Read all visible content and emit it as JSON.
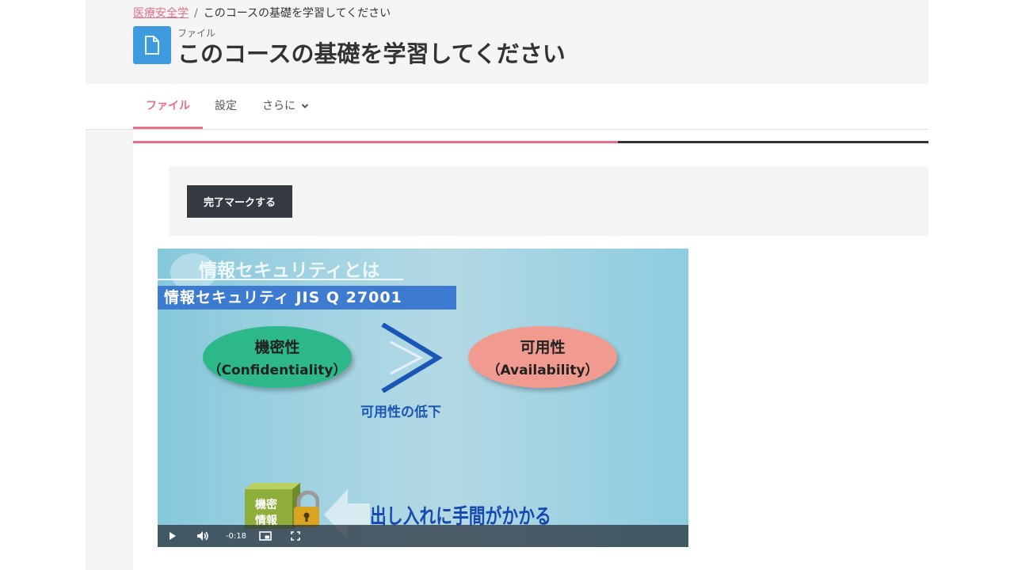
{
  "breadcrumb": {
    "course": "医療安全学",
    "separator": "/",
    "current": "このコースの基礎を学習してください"
  },
  "header": {
    "activity_type": "ファイル",
    "title": "このコースの基礎を学習してください",
    "icon": "file-icon"
  },
  "nav": {
    "tabs": [
      {
        "label": "ファイル",
        "active": true
      },
      {
        "label": "設定",
        "active": false
      },
      {
        "label": "さらに",
        "active": false,
        "icon": "chevron-down-icon"
      }
    ]
  },
  "progress": {
    "fraction": 0.61
  },
  "completion": {
    "button_label": "完了マークする"
  },
  "video": {
    "slide": {
      "title": "情報セキュリティとは",
      "banner": "情報セキュリティ JIS Q 27001",
      "left_ellipse": {
        "line1": "機密性",
        "line2": "（Confidentiality）"
      },
      "right_ellipse": {
        "line1": "可用性",
        "line2": "（Availability）"
      },
      "comparison_caption": "可用性の低下",
      "cube_label": [
        "機密",
        "情報"
      ],
      "bottom_text": "出し入れに手間がかかる"
    },
    "controls": {
      "time": "-0:18"
    }
  },
  "colors": {
    "accent": "#e76f87",
    "file_icon_bg": "#3f9bdf",
    "button_dark": "#343a40",
    "ellipse_left": "#2db88a",
    "ellipse_right": "#f09a90",
    "banner": "#3d7bd0"
  }
}
